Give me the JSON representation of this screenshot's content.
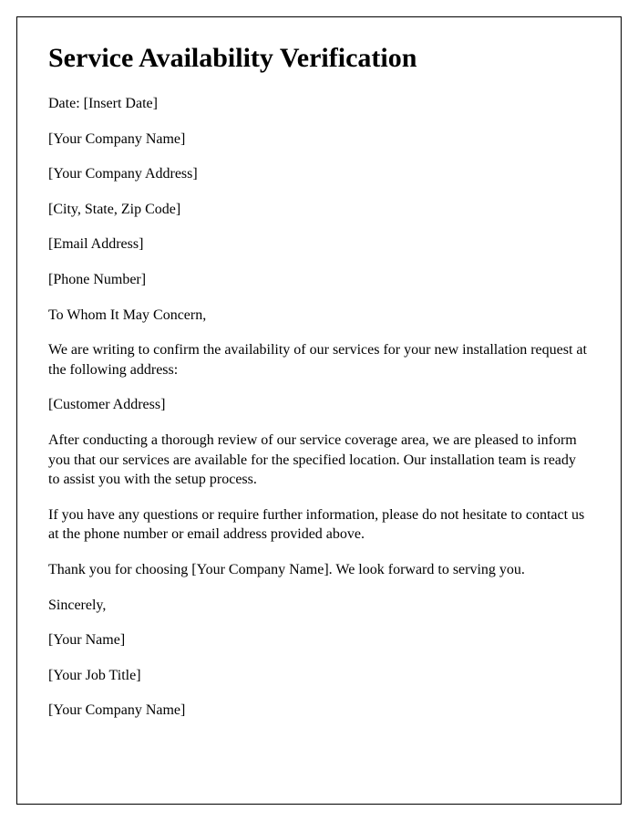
{
  "title": "Service Availability Verification",
  "lines": {
    "date": "Date: [Insert Date]",
    "companyName": "[Your Company Name]",
    "companyAddress": "[Your Company Address]",
    "cityStateZip": "[City, State, Zip Code]",
    "email": "[Email Address]",
    "phone": "[Phone Number]",
    "salutation": "To Whom It May Concern,",
    "para1": "We are writing to confirm the availability of our services for your new installation request at the following address:",
    "customerAddress": "[Customer Address]",
    "para2": "After conducting a thorough review of our service coverage area, we are pleased to inform you that our services are available for the specified location. Our installation team is ready to assist you with the setup process.",
    "para3": "If you have any questions or require further information, please do not hesitate to contact us at the phone number or email address provided above.",
    "para4": "Thank you for choosing [Your Company Name]. We look forward to serving you.",
    "closing": "Sincerely,",
    "signerName": "[Your Name]",
    "signerTitle": "[Your Job Title]",
    "signerCompany": "[Your Company Name]"
  }
}
